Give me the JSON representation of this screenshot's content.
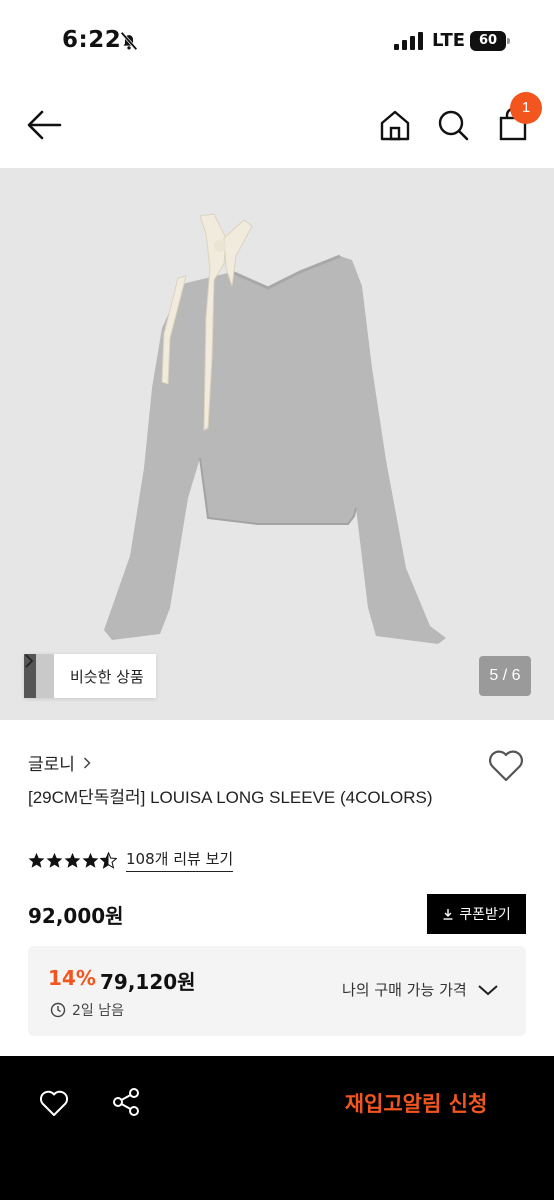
{
  "status_bar": {
    "time": "6:22",
    "network": "LTE",
    "battery": "60"
  },
  "nav": {
    "cart_count": "1"
  },
  "gallery": {
    "page_counter": "5 / 6",
    "similar_label": "비슷한 상품"
  },
  "product": {
    "brand": "글로니",
    "title": "[29CM단독컬러] LOUISA LONG SLEEVE (4COLORS)",
    "rating": 4.5,
    "review_link": "108개 리뷰 보기",
    "price": "92,000원",
    "coupon_label": "쿠폰받기",
    "discount_rate": "14%",
    "discount_price": "79,120원",
    "time_left": "2일 남음",
    "my_price_label": "나의 구매 가능 가격"
  },
  "bottom_bar": {
    "restock_label": "재입고알림 신청"
  },
  "colors": {
    "accent": "#f2561e",
    "image_bg": "#e6e6e6",
    "bottom_bar": "#000000"
  },
  "icons": [
    "bell-slash-icon",
    "signal-icon",
    "back-arrow-icon",
    "home-icon",
    "search-icon",
    "shopping-bag-icon",
    "heart-icon",
    "share-icon",
    "download-icon",
    "clock-icon",
    "chevron-down-icon",
    "chevron-right-icon",
    "star-icon"
  ]
}
